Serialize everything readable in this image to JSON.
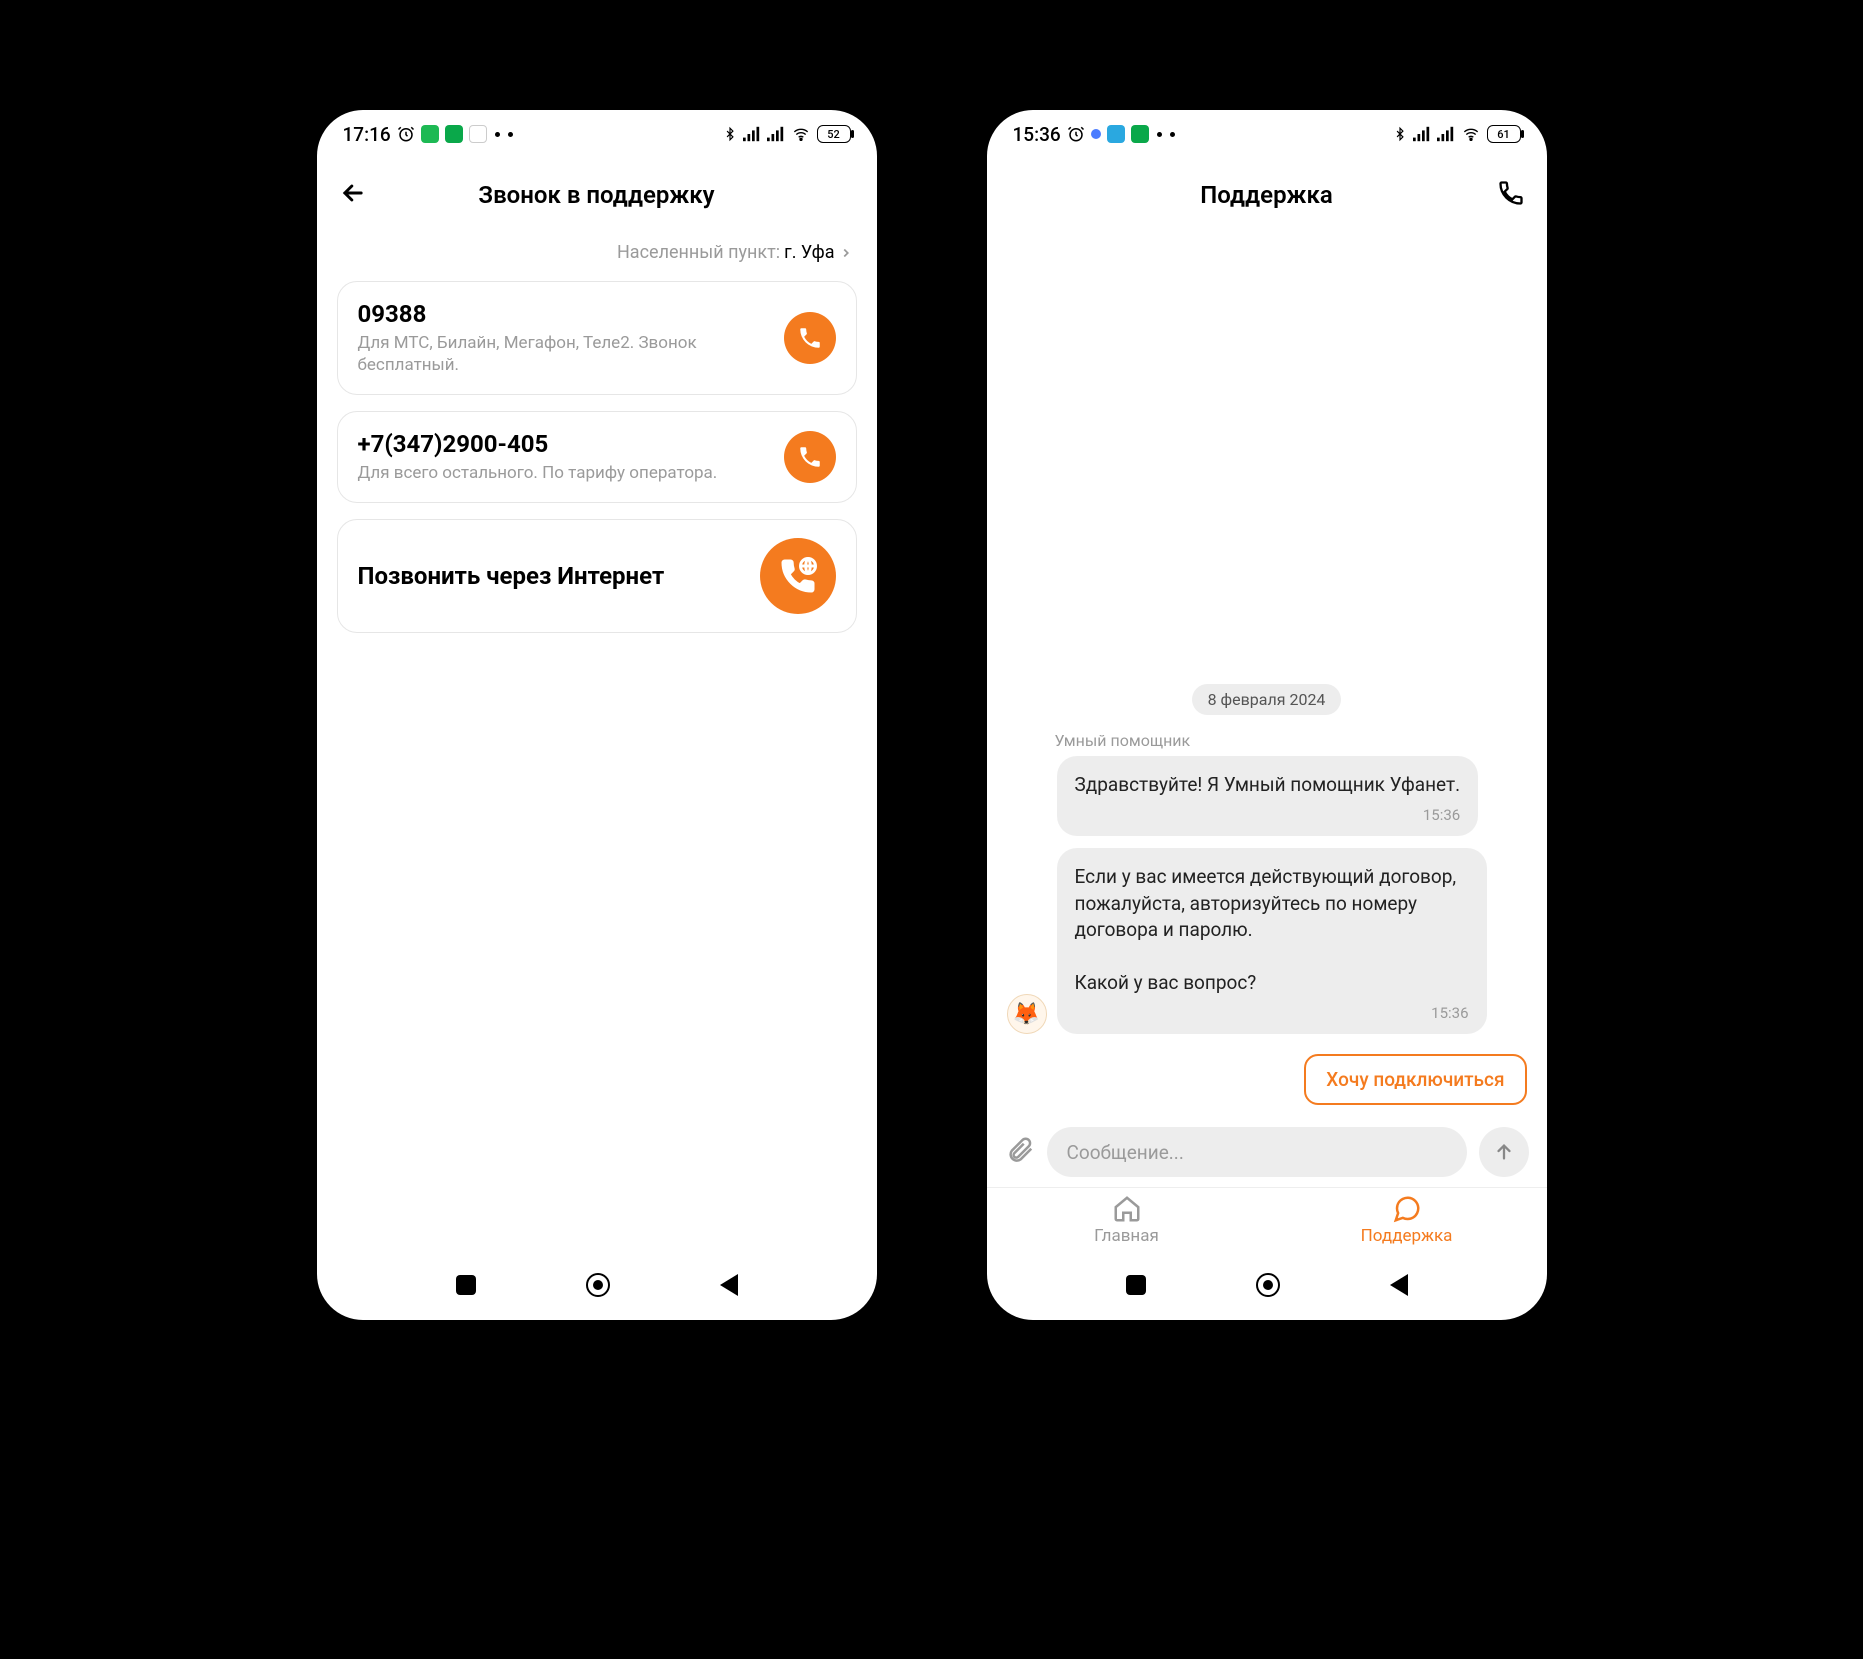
{
  "phones": {
    "left": {
      "status": {
        "time": "17:16",
        "battery": "52"
      },
      "header": {
        "title": "Звонок в поддержку"
      },
      "location": {
        "label": "Населенный пункт:",
        "city": "г. Уфа"
      },
      "cards": [
        {
          "number": "09388",
          "sub": "Для МТС, Билайн, Мегафон, Теле2. Звонок бесплатный."
        },
        {
          "number": "+7(347)2900-405",
          "sub": "Для всего остального. По тарифу оператора."
        }
      ],
      "internet": {
        "label": "Позвонить через Интернет"
      }
    },
    "right": {
      "status": {
        "time": "15:36",
        "battery": "61"
      },
      "header": {
        "title": "Поддержка"
      },
      "date": "8 февраля 2024",
      "sender": "Умный помощник",
      "messages": [
        {
          "text": "Здравствуйте! Я Умный помощник Уфанет.",
          "time": "15:36"
        },
        {
          "text": "Если у вас имеется действующий договор, пожалуйста, авторизуйтесь по номеру договора и паролю.\n\nКакой у вас вопрос?",
          "time": "15:36"
        }
      ],
      "quick_reply": "Хочу подключиться",
      "composer": {
        "placeholder": "Сообщение..."
      },
      "tabs": {
        "home": "Главная",
        "support": "Поддержка"
      }
    }
  }
}
